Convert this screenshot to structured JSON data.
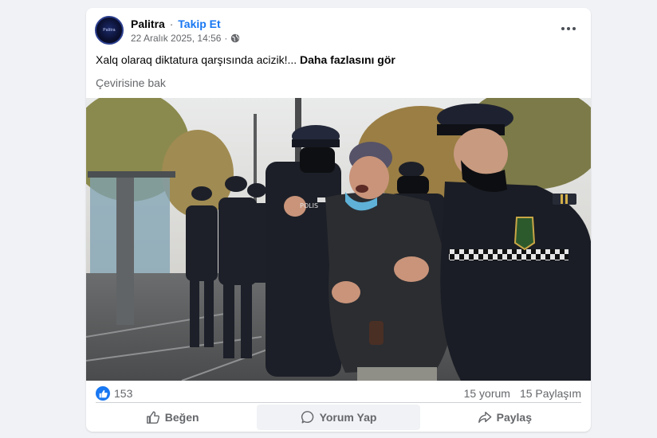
{
  "post": {
    "page_name": "Palitra",
    "separator": "·",
    "follow_label": "Takip Et",
    "timestamp": "22 Aralık 2025, 14:56",
    "avatar_text": "Palitra",
    "text": "Xalq olaraq diktatura qarşısında acizik!...",
    "see_more_label": "Daha fazlasını gör",
    "translate_label": "Çevirisine bak",
    "photo_badge_text": "POLIS"
  },
  "stats": {
    "like_count": "153",
    "comments": "15 yorum",
    "shares": "15 Paylaşım"
  },
  "actions": {
    "like_label": "Beğen",
    "comment_label": "Yorum Yap",
    "share_label": "Paylaş"
  },
  "colors": {
    "accent": "#1877f2",
    "muted_text": "#65676b",
    "card_bg": "#ffffff",
    "page_bg": "#f0f2f5"
  },
  "icons": {
    "privacy": "globe-icon",
    "more": "more-options-icon",
    "like": "thumbs-up-icon",
    "comment": "comment-bubble-icon",
    "share": "share-arrow-icon"
  }
}
